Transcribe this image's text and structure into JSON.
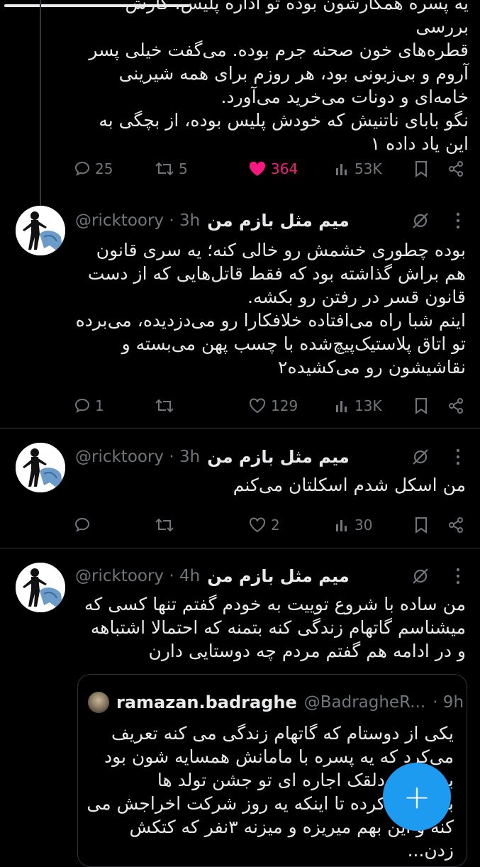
{
  "tweets": [
    {
      "body": "یه پسره همکارشون بوده تو اداره پلیس، کارش بررسی\nقطره‌های خون صحنه جرم بوده. می‌گفت خیلی پسر\nآروم و بی‌زبونی بود، هر روزم برای همه شیرینی\nخامه‌ای و دونات می‌خرید می‌آورد.\nنگو بابای ناتنیش که خودش پلیس بوده، از بچگی به\nاین یاد داده ۱",
      "replies": "25",
      "retweets": "5",
      "likes": "364",
      "views": "53K"
    },
    {
      "name": "میم مثل بازم من",
      "handle": "@ricktoory · 3h",
      "body": "بوده چطوری خشمش رو خالی کنه؛ یه سری قانون\nهم براش گذاشته بود که فقط قاتل‌هایی که از دست\nقانون قسر در رفتن رو بکشه.\nاینم شبا راه می‌افتاده خلافکارا رو می‌دزدیده، می‌برده\nتو اتاق پلاستیک‌پیچ‌شده با چسب پهن می‌بسته و\nنقاشیشون رو می‌کشیده۲",
      "replies": "1",
      "retweets": "",
      "likes": "129",
      "views": "13K"
    },
    {
      "name": "میم مثل بازم من",
      "handle": "@ricktoory · 3h",
      "body": "من اسکل شدم اسکلتان می‌کنم",
      "replies": "",
      "retweets": "",
      "likes": "2",
      "views": "30"
    },
    {
      "name": "میم مثل بازم من",
      "handle": "@ricktoory · 4h",
      "body": "من ساده با شروع توییت به خودم  گفتم تنها کسی که\nمیشناسم گاتهام زندگی کنه بتمنه که احتمالا اشتباهه\nو در ادامه هم گفتم مردم چه دوستایی دارن",
      "quote": {
        "name": "ramazan.badraghe",
        "handle": "@BadragheR...",
        "time": "· 9h",
        "body": "یکی از دوستام که گاتهام زندگی می کنه تعریف\nمی‌کرد که یه پسره با مامانش همسایه شون بود\nبه عنوان دلقک اجاره ای تو جشن تولد ها\nبازی می کرده تا اینکه یه روز شرکت اخراجش می\nکنه و این بهم میریزه و میزنه ۳نفر که کتکش زدن..."
      }
    }
  ],
  "colors": {
    "background": "#000000",
    "text": "#e7e9ea",
    "muted": "#71767b",
    "like_active": "#f91880",
    "accent": "#1d9bf0",
    "divider": "#2f3336"
  },
  "fab_label": "+"
}
